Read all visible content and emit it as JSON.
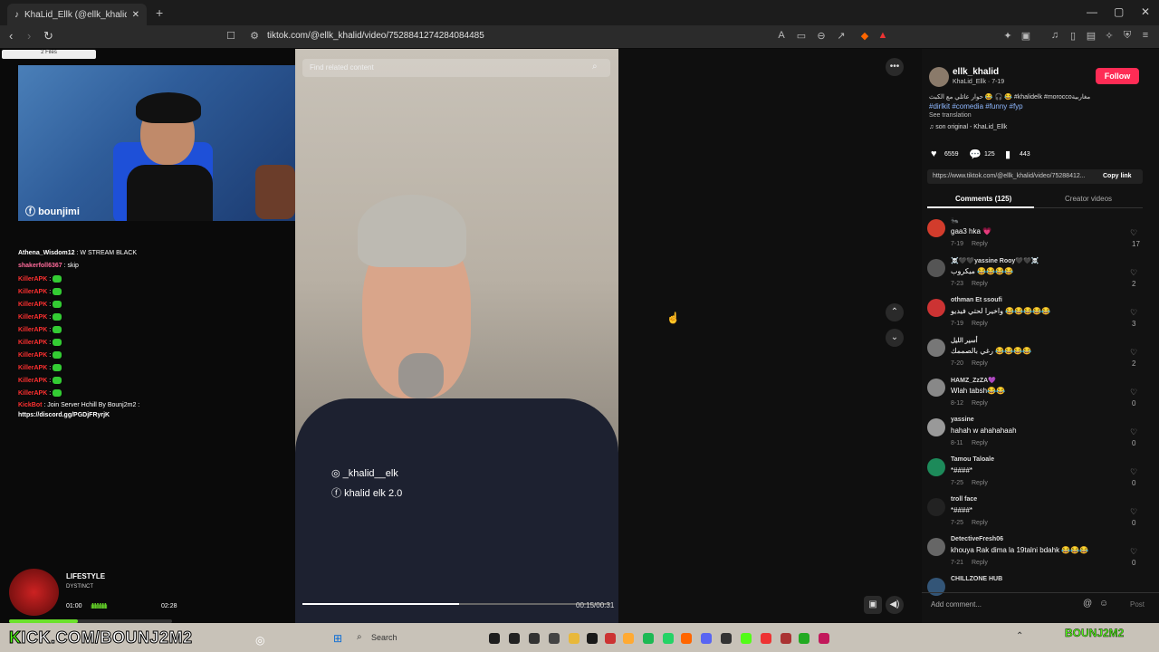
{
  "browser": {
    "tab_title": "KhaLid_Ellk (@ellk_khalid) | Ti",
    "url": "tiktok.com/@ellk_khalid/video/7528841274284084485"
  },
  "stream": {
    "files_label": "2 Files",
    "cam_name": "bounjimi",
    "chat": [
      {
        "user": "Athena_Wisdom12",
        "msg": "W STREAM BLACK",
        "color": "#ffffff"
      },
      {
        "user": "shakerfoll6367",
        "msg": "skip",
        "color": "#ff6b9b"
      },
      {
        "user": "KillerAPK",
        "msg": "",
        "color": "#ff3030"
      },
      {
        "user": "KillerAPK",
        "msg": "",
        "color": "#ff3030"
      },
      {
        "user": "KillerAPK",
        "msg": "",
        "color": "#ff3030"
      },
      {
        "user": "KillerAPK",
        "msg": "",
        "color": "#ff3030"
      },
      {
        "user": "KillerAPK",
        "msg": "",
        "color": "#ff3030"
      },
      {
        "user": "KillerAPK",
        "msg": "",
        "color": "#ff3030"
      },
      {
        "user": "KillerAPK",
        "msg": "",
        "color": "#ff3030"
      },
      {
        "user": "KillerAPK",
        "msg": "",
        "color": "#ff3030"
      },
      {
        "user": "KillerAPK",
        "msg": "",
        "color": "#ff3030"
      },
      {
        "user": "KillerAPK",
        "msg": "",
        "color": "#ff3030"
      },
      {
        "user": "KickBot",
        "msg": "Join Server Hchill By Bounj2m2 :",
        "color": "#ff3030"
      }
    ],
    "chat_link": "https://discord.gg/PGDjFRyrjK",
    "now_playing": {
      "title": "LIFESTYLE",
      "artist": "DYSTINCT",
      "elapsed": "01:00",
      "total": "02:28"
    },
    "kick_prefix": "K",
    "kick_rest": "ICK.COM/BOUNJ2M2",
    "streamer_tag": "BOUNJ2M2"
  },
  "video": {
    "search_placeholder": "Find related content",
    "ig": "_khalid__elk",
    "fb": "khalid elk 2.0",
    "time": "00:15/00:31"
  },
  "panel": {
    "username": "ellk_khalid",
    "meta": "KhaLid_Ellk · 7-19",
    "follow": "Follow",
    "desc": "حوار عائلي مع الكبث 😂 🎧 😂 #khalidelk #moroccoمغاربية",
    "tags": "#dirlkit #comedia #funny #fyp",
    "see_translation": "See translation",
    "sound": "son original - KhaLid_Ellk",
    "likes": "6559",
    "comments_count": "125",
    "saves": "443",
    "link": "https://www.tiktok.com/@ellk_khalid/video/75288412...",
    "copy_link": "Copy link",
    "tab_comments": "Comments (125)",
    "tab_creator": "Creator videos",
    "add_comment": "Add comment...",
    "post": "Post"
  },
  "comments": [
    {
      "user": "🐜",
      "text": "gaa3 hka 💗",
      "date": "7-19",
      "likes": "17",
      "color": "#d23c2c"
    },
    {
      "user": "☠️🖤🖤yassine Rooy🖤🖤☠️",
      "text": "ميكروب 😂😂😂😂",
      "date": "7-23",
      "likes": "2",
      "color": "#555"
    },
    {
      "user": "othman Et ssoufi",
      "text": "واخيرا لحتي فيديو 😂😂😂😂😂",
      "date": "7-19",
      "likes": "3",
      "color": "#c33"
    },
    {
      "user": "أسير الليل",
      "text": "رغي بالصممك 😂😂😂😂",
      "date": "7-20",
      "likes": "2",
      "color": "#777"
    },
    {
      "user": "HAMZ_ZzZA💜",
      "text": "Wlah tabsh😂😂",
      "date": "8-12",
      "likes": "0",
      "color": "#888"
    },
    {
      "user": "yassine",
      "text": "hahah w ahahahaah",
      "date": "8-11",
      "likes": "0",
      "color": "#999"
    },
    {
      "user": "Tamou Taloale",
      "text": "*####*",
      "date": "7-25",
      "likes": "0",
      "color": "#1d8a5a"
    },
    {
      "user": "troll face",
      "text": "*####*",
      "date": "7-25",
      "likes": "0",
      "color": "#222"
    },
    {
      "user": "DetectiveFresh06",
      "text": "khouya Rak dima la 19talni bdahk 😂😂😂",
      "date": "7-21",
      "likes": "0",
      "color": "#666"
    },
    {
      "user": "CHILLZONE HUB",
      "text": "",
      "date": "",
      "likes": "",
      "color": "#357"
    }
  ],
  "comment_reply": "Reply",
  "taskbar": {
    "search": "Search"
  }
}
